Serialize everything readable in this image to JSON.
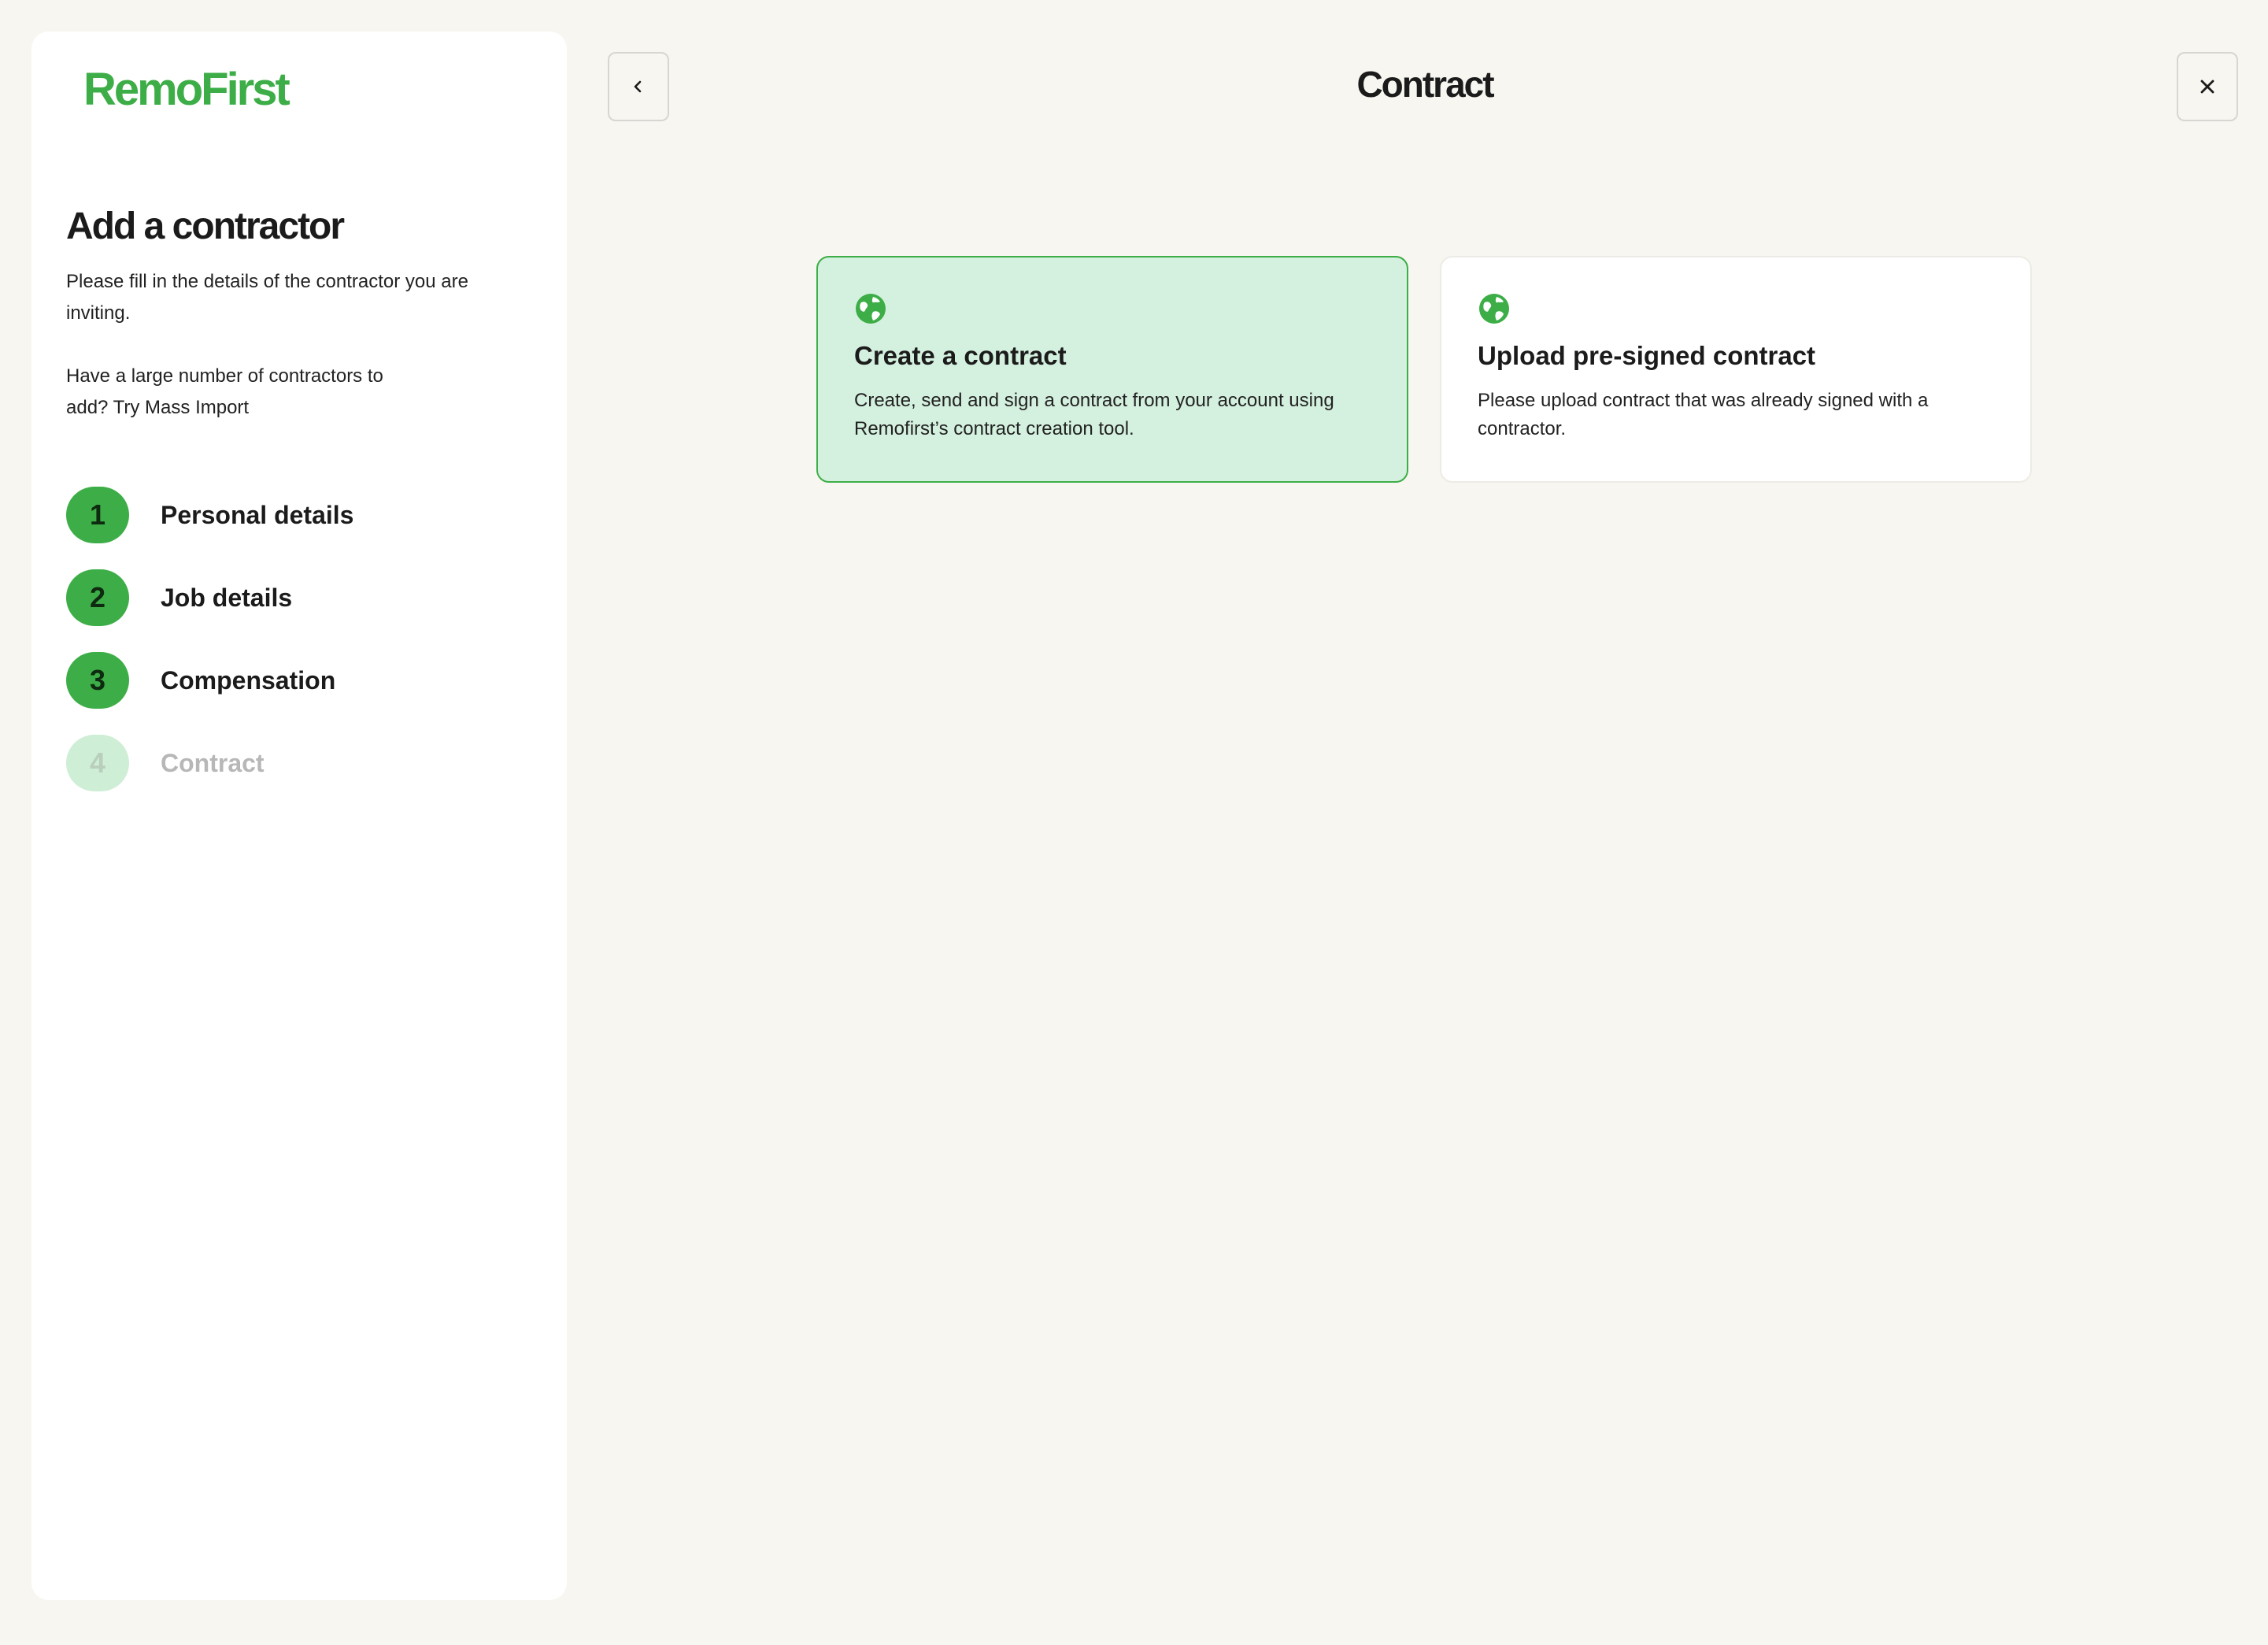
{
  "brand": {
    "logo_text": "RemoFirst",
    "accent_color": "#3dae47",
    "selected_card_bg": "#d4f0de"
  },
  "sidebar": {
    "title": "Add a contractor",
    "description": "Please fill in the details of the contractor you are inviting.",
    "hint": "Have a large number of contractors to add? Try Mass Import",
    "steps": [
      {
        "number": "1",
        "label": "Personal details",
        "state": "completed"
      },
      {
        "number": "2",
        "label": "Job details",
        "state": "completed"
      },
      {
        "number": "3",
        "label": "Compensation",
        "state": "completed"
      },
      {
        "number": "4",
        "label": "Contract",
        "state": "current"
      }
    ]
  },
  "header": {
    "title": "Contract",
    "back_icon": "chevron-left-icon",
    "close_icon": "close-icon"
  },
  "options": [
    {
      "icon": "globe-icon",
      "title": "Create a contract",
      "description": "Create, send and sign a contract from your account using Remofirst’s contract creation tool.",
      "selected": true
    },
    {
      "icon": "globe-icon",
      "title": "Upload pre-signed contract",
      "description": "Please upload contract that was already signed with a contractor.",
      "selected": false
    }
  ]
}
